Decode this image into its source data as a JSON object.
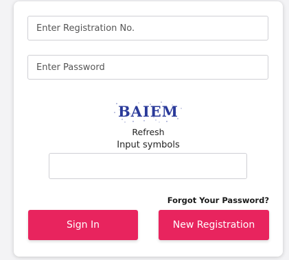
{
  "login": {
    "registration_placeholder": "Enter Registration No.",
    "password_placeholder": "Enter Password",
    "captcha_text": "BAIEM",
    "refresh_label": "Refresh",
    "symbols_label": "Input symbols",
    "forgot_label": "Forgot Your Password?",
    "signin_label": "Sign In",
    "new_registration_label": "New Registration"
  },
  "colors": {
    "accent": "#e8245e",
    "captcha_text": "#2a3a9a"
  }
}
